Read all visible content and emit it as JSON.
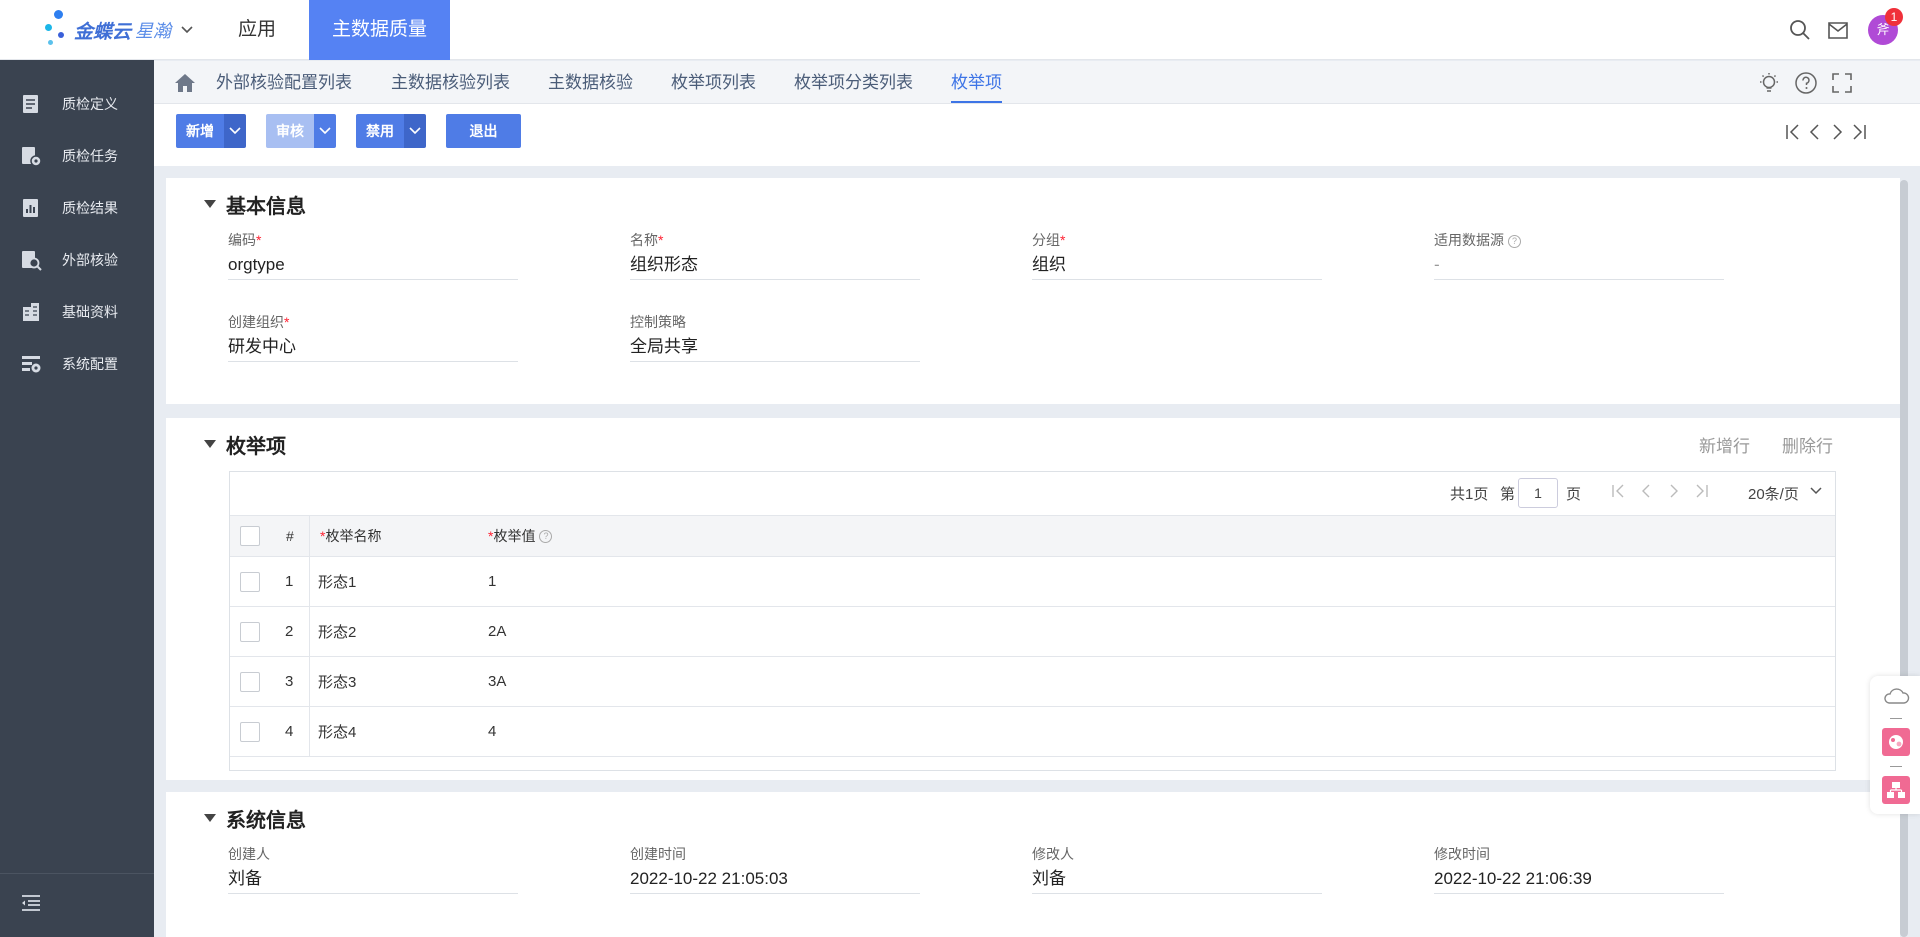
{
  "topbar": {
    "brand": "金蝶云",
    "brand_sub": "星瀚",
    "nav_apps": "应用",
    "nav_active": "主数据质量",
    "badge_count": "1",
    "avatar_text": "斧",
    "icons": [
      "search-icon",
      "mail-icon"
    ]
  },
  "sidebar": {
    "items": [
      {
        "label": "质检定义",
        "icon": "document-icon"
      },
      {
        "label": "质检任务",
        "icon": "task-gear-icon"
      },
      {
        "label": "质检结果",
        "icon": "result-chart-icon"
      },
      {
        "label": "外部核验",
        "icon": "doc-search-icon"
      },
      {
        "label": "基础资料",
        "icon": "building-icon"
      },
      {
        "label": "系统配置",
        "icon": "settings-list-icon"
      }
    ]
  },
  "tabs": [
    {
      "label": "外部核验配置列表"
    },
    {
      "label": "主数据核验列表"
    },
    {
      "label": "主数据核验"
    },
    {
      "label": "枚举项列表"
    },
    {
      "label": "枚举项分类列表"
    },
    {
      "label": "枚举项",
      "active": true
    }
  ],
  "toolbar": {
    "add_label": "新增",
    "audit_label": "审核",
    "disable_label": "禁用",
    "exit_label": "退出"
  },
  "basic": {
    "title": "基本信息",
    "fields": {
      "code": {
        "label": "编码",
        "value": "orgtype"
      },
      "name": {
        "label": "名称",
        "value": "组织形态"
      },
      "group": {
        "label": "分组",
        "value": "组织"
      },
      "datasource": {
        "label": "适用数据源",
        "value": "-"
      },
      "create_org": {
        "label": "创建组织",
        "value": "研发中心"
      },
      "policy": {
        "label": "控制策略",
        "value": "全局共享"
      }
    }
  },
  "enum": {
    "title": "枚举项",
    "add_row": "新增行",
    "delete_row": "删除行",
    "pager": {
      "total": "共1页",
      "page_prefix": "第",
      "page": "1",
      "page_suffix": "页",
      "page_size": "20条/页"
    },
    "columns": {
      "index": "#",
      "name": "枚举名称",
      "value": "枚举值"
    },
    "rows": [
      {
        "index": "1",
        "name": "形态1",
        "value": "1"
      },
      {
        "index": "2",
        "name": "形态2",
        "value": "2A"
      },
      {
        "index": "3",
        "name": "形态3",
        "value": "3A"
      },
      {
        "index": "4",
        "name": "形态4",
        "value": "4"
      }
    ]
  },
  "system": {
    "title": "系统信息",
    "fields": {
      "creator": {
        "label": "创建人",
        "value": "刘备"
      },
      "create_time": {
        "label": "创建时间",
        "value": "2022-10-22 21:05:03"
      },
      "modifier": {
        "label": "修改人",
        "value": "刘备"
      },
      "modify_time": {
        "label": "修改时间",
        "value": "2022-10-22 21:06:39"
      }
    }
  },
  "colors": {
    "accent": "#5582f3",
    "sidebar_bg": "#3a4350",
    "required": "#ff2233"
  }
}
